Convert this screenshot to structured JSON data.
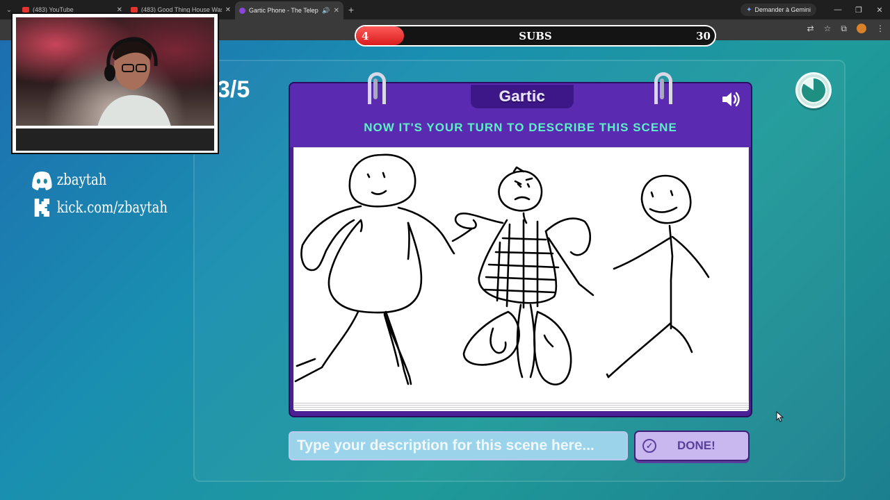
{
  "browser": {
    "tabs": [
      {
        "title": "(483) YouTube",
        "favicon": "youtube-icon",
        "active": false
      },
      {
        "title": "(483) Good Thing House Was",
        "favicon": "youtube-icon",
        "active": false
      },
      {
        "title": "Gartic Phone - The Telepho",
        "favicon": "gartic-icon",
        "active": true
      }
    ],
    "gemini_label": "Demander à Gemini"
  },
  "subs_goal": {
    "current": "4",
    "label": "SUBS",
    "goal": "30",
    "progress_fraction": 0.133,
    "fill_color": "#e8262a"
  },
  "game": {
    "round": "3/5",
    "brand": "Gartic",
    "instruction": "NOW IT'S YOUR TURN TO DESCRIBE THIS SCENE",
    "description_placeholder": "Type your description for this scene here...",
    "done_label": "DONE!",
    "accent_color": "#5df1c8",
    "panel_color": "#5a2bb0"
  },
  "overlay": {
    "discord_handle": "zbaytah",
    "kick_url": "kick.com/zbaytah"
  }
}
